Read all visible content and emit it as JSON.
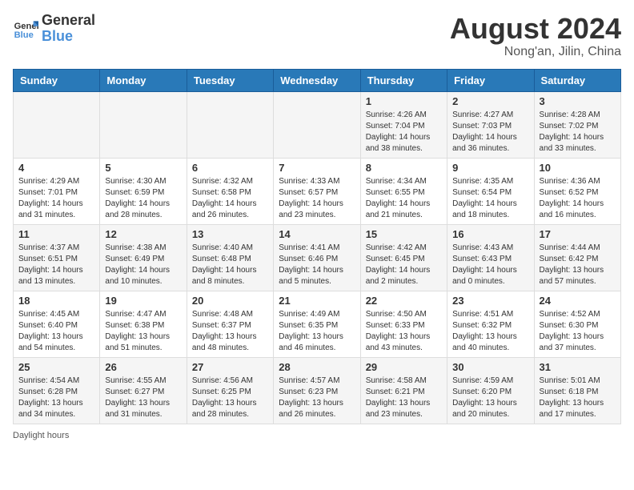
{
  "logo": {
    "line1": "General",
    "line2": "Blue"
  },
  "title": "August 2024",
  "subtitle": "Nong'an, Jilin, China",
  "days_of_week": [
    "Sunday",
    "Monday",
    "Tuesday",
    "Wednesday",
    "Thursday",
    "Friday",
    "Saturday"
  ],
  "weeks": [
    [
      {
        "day": "",
        "info": ""
      },
      {
        "day": "",
        "info": ""
      },
      {
        "day": "",
        "info": ""
      },
      {
        "day": "",
        "info": ""
      },
      {
        "day": "1",
        "info": "Sunrise: 4:26 AM\nSunset: 7:04 PM\nDaylight: 14 hours\nand 38 minutes."
      },
      {
        "day": "2",
        "info": "Sunrise: 4:27 AM\nSunset: 7:03 PM\nDaylight: 14 hours\nand 36 minutes."
      },
      {
        "day": "3",
        "info": "Sunrise: 4:28 AM\nSunset: 7:02 PM\nDaylight: 14 hours\nand 33 minutes."
      }
    ],
    [
      {
        "day": "4",
        "info": "Sunrise: 4:29 AM\nSunset: 7:01 PM\nDaylight: 14 hours\nand 31 minutes."
      },
      {
        "day": "5",
        "info": "Sunrise: 4:30 AM\nSunset: 6:59 PM\nDaylight: 14 hours\nand 28 minutes."
      },
      {
        "day": "6",
        "info": "Sunrise: 4:32 AM\nSunset: 6:58 PM\nDaylight: 14 hours\nand 26 minutes."
      },
      {
        "day": "7",
        "info": "Sunrise: 4:33 AM\nSunset: 6:57 PM\nDaylight: 14 hours\nand 23 minutes."
      },
      {
        "day": "8",
        "info": "Sunrise: 4:34 AM\nSunset: 6:55 PM\nDaylight: 14 hours\nand 21 minutes."
      },
      {
        "day": "9",
        "info": "Sunrise: 4:35 AM\nSunset: 6:54 PM\nDaylight: 14 hours\nand 18 minutes."
      },
      {
        "day": "10",
        "info": "Sunrise: 4:36 AM\nSunset: 6:52 PM\nDaylight: 14 hours\nand 16 minutes."
      }
    ],
    [
      {
        "day": "11",
        "info": "Sunrise: 4:37 AM\nSunset: 6:51 PM\nDaylight: 14 hours\nand 13 minutes."
      },
      {
        "day": "12",
        "info": "Sunrise: 4:38 AM\nSunset: 6:49 PM\nDaylight: 14 hours\nand 10 minutes."
      },
      {
        "day": "13",
        "info": "Sunrise: 4:40 AM\nSunset: 6:48 PM\nDaylight: 14 hours\nand 8 minutes."
      },
      {
        "day": "14",
        "info": "Sunrise: 4:41 AM\nSunset: 6:46 PM\nDaylight: 14 hours\nand 5 minutes."
      },
      {
        "day": "15",
        "info": "Sunrise: 4:42 AM\nSunset: 6:45 PM\nDaylight: 14 hours\nand 2 minutes."
      },
      {
        "day": "16",
        "info": "Sunrise: 4:43 AM\nSunset: 6:43 PM\nDaylight: 14 hours\nand 0 minutes."
      },
      {
        "day": "17",
        "info": "Sunrise: 4:44 AM\nSunset: 6:42 PM\nDaylight: 13 hours\nand 57 minutes."
      }
    ],
    [
      {
        "day": "18",
        "info": "Sunrise: 4:45 AM\nSunset: 6:40 PM\nDaylight: 13 hours\nand 54 minutes."
      },
      {
        "day": "19",
        "info": "Sunrise: 4:47 AM\nSunset: 6:38 PM\nDaylight: 13 hours\nand 51 minutes."
      },
      {
        "day": "20",
        "info": "Sunrise: 4:48 AM\nSunset: 6:37 PM\nDaylight: 13 hours\nand 48 minutes."
      },
      {
        "day": "21",
        "info": "Sunrise: 4:49 AM\nSunset: 6:35 PM\nDaylight: 13 hours\nand 46 minutes."
      },
      {
        "day": "22",
        "info": "Sunrise: 4:50 AM\nSunset: 6:33 PM\nDaylight: 13 hours\nand 43 minutes."
      },
      {
        "day": "23",
        "info": "Sunrise: 4:51 AM\nSunset: 6:32 PM\nDaylight: 13 hours\nand 40 minutes."
      },
      {
        "day": "24",
        "info": "Sunrise: 4:52 AM\nSunset: 6:30 PM\nDaylight: 13 hours\nand 37 minutes."
      }
    ],
    [
      {
        "day": "25",
        "info": "Sunrise: 4:54 AM\nSunset: 6:28 PM\nDaylight: 13 hours\nand 34 minutes."
      },
      {
        "day": "26",
        "info": "Sunrise: 4:55 AM\nSunset: 6:27 PM\nDaylight: 13 hours\nand 31 minutes."
      },
      {
        "day": "27",
        "info": "Sunrise: 4:56 AM\nSunset: 6:25 PM\nDaylight: 13 hours\nand 28 minutes."
      },
      {
        "day": "28",
        "info": "Sunrise: 4:57 AM\nSunset: 6:23 PM\nDaylight: 13 hours\nand 26 minutes."
      },
      {
        "day": "29",
        "info": "Sunrise: 4:58 AM\nSunset: 6:21 PM\nDaylight: 13 hours\nand 23 minutes."
      },
      {
        "day": "30",
        "info": "Sunrise: 4:59 AM\nSunset: 6:20 PM\nDaylight: 13 hours\nand 20 minutes."
      },
      {
        "day": "31",
        "info": "Sunrise: 5:01 AM\nSunset: 6:18 PM\nDaylight: 13 hours\nand 17 minutes."
      }
    ]
  ],
  "footer": "Daylight hours"
}
